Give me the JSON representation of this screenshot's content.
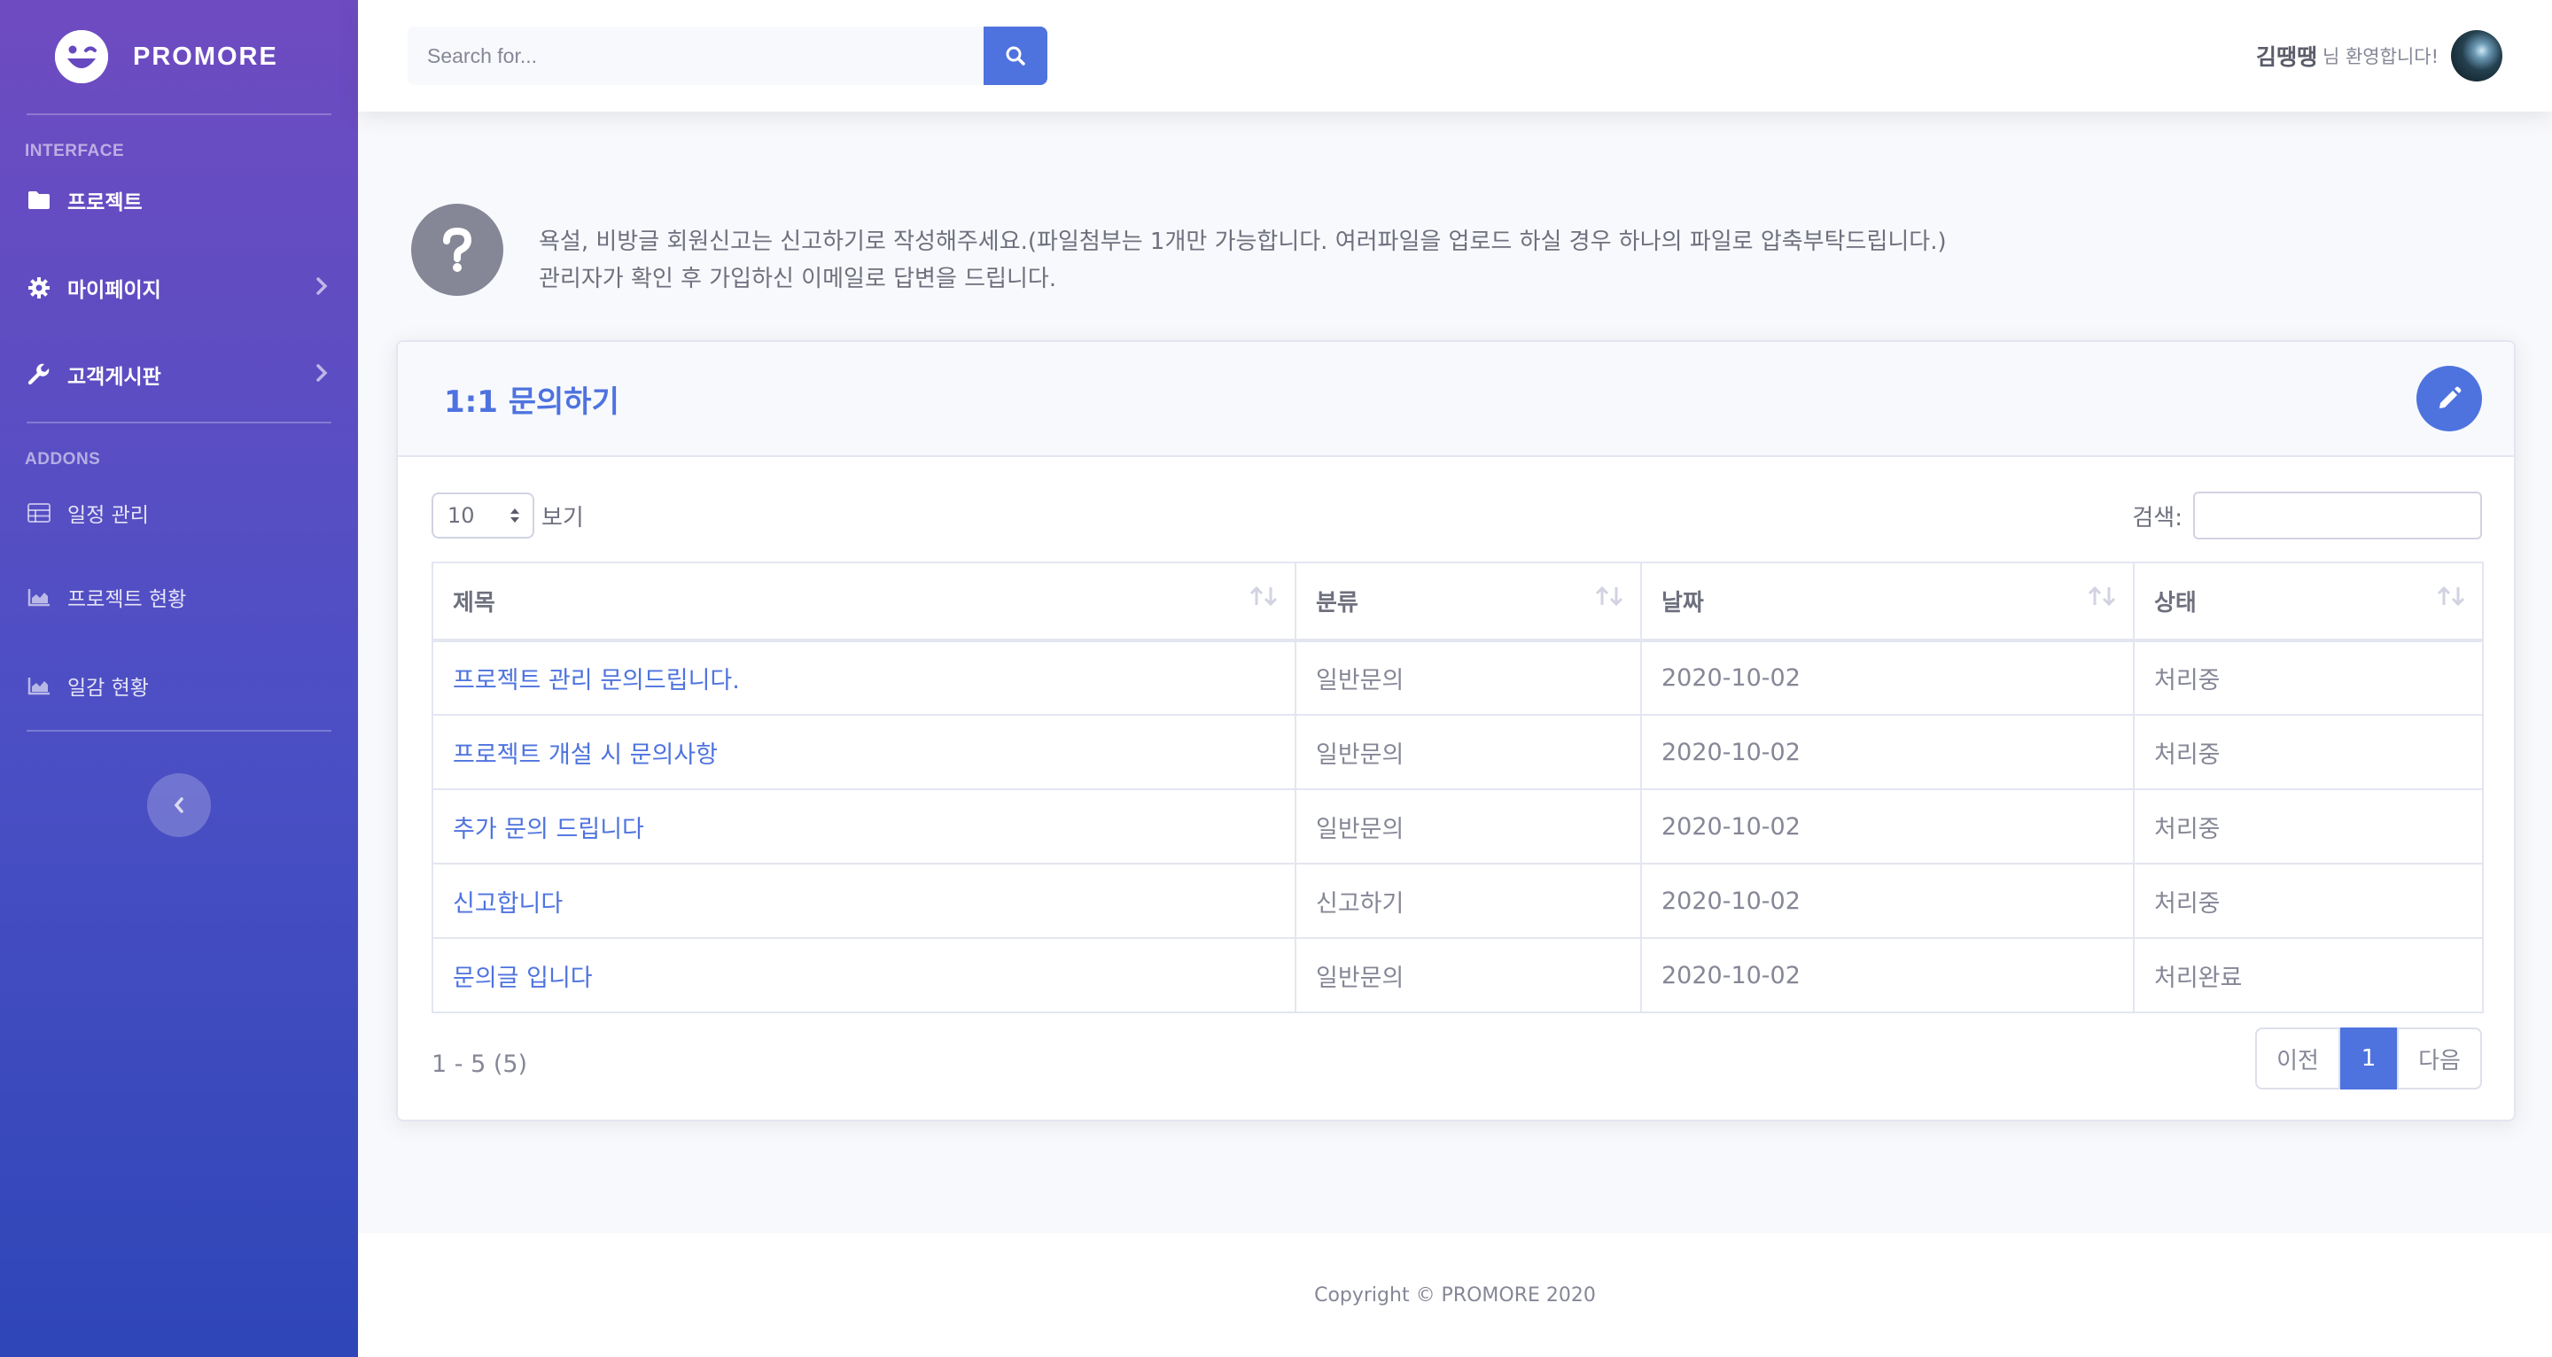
{
  "sidebar": {
    "brand": "PROMORE",
    "heading_interface": "INTERFACE",
    "heading_addons": "ADDONS",
    "items": [
      {
        "label": "프로젝트",
        "icon": "folder-icon"
      },
      {
        "label": "마이페이지",
        "icon": "gear-icon"
      },
      {
        "label": "고객게시판",
        "icon": "wrench-icon"
      },
      {
        "label": "일정 관리",
        "icon": "table-icon"
      },
      {
        "label": "프로젝트 현황",
        "icon": "area-chart-icon"
      },
      {
        "label": "일감 현황",
        "icon": "area-chart-icon"
      }
    ]
  },
  "topbar": {
    "search_placeholder": "Search for...",
    "user_name": "김땡땡",
    "user_suffix": "님 환영합니다!"
  },
  "notice": {
    "line1": "욕설, 비방글 회원신고는 신고하기로 작성해주세요.(파일첨부는 1개만 가능합니다. 여러파일을 업로드 하실 경우 하나의 파일로 압축부탁드립니다.)",
    "line2": "관리자가 확인 후 가입하신 이메일로 답변을 드립니다."
  },
  "card": {
    "title": "1:1 문의하기",
    "length_value": "10",
    "length_label": "보기",
    "filter_label": "검색:",
    "columns": [
      "제목",
      "분류",
      "날짜",
      "상태"
    ],
    "rows": [
      [
        "프로젝트 관리 문의드립니다.",
        "일반문의",
        "2020-10-02",
        "처리중"
      ],
      [
        "프로젝트 개설 시 문의사항",
        "일반문의",
        "2020-10-02",
        "처리중"
      ],
      [
        "추가 문의 드립니다",
        "일반문의",
        "2020-10-02",
        "처리중"
      ],
      [
        "신고합니다",
        "신고하기",
        "2020-10-02",
        "처리중"
      ],
      [
        "문의글 입니다",
        "일반문의",
        "2020-10-02",
        "처리완료"
      ]
    ],
    "info": "1 - 5 (5)",
    "pagination": {
      "prev": "이전",
      "current": "1",
      "next": "다음"
    }
  },
  "footer": "Copyright © PROMORE 2020",
  "colors": {
    "primary": "#4e73df",
    "sidebar_top": "#6f4bc1",
    "sidebar_bottom": "#2e46b8",
    "text_muted": "#858796"
  }
}
